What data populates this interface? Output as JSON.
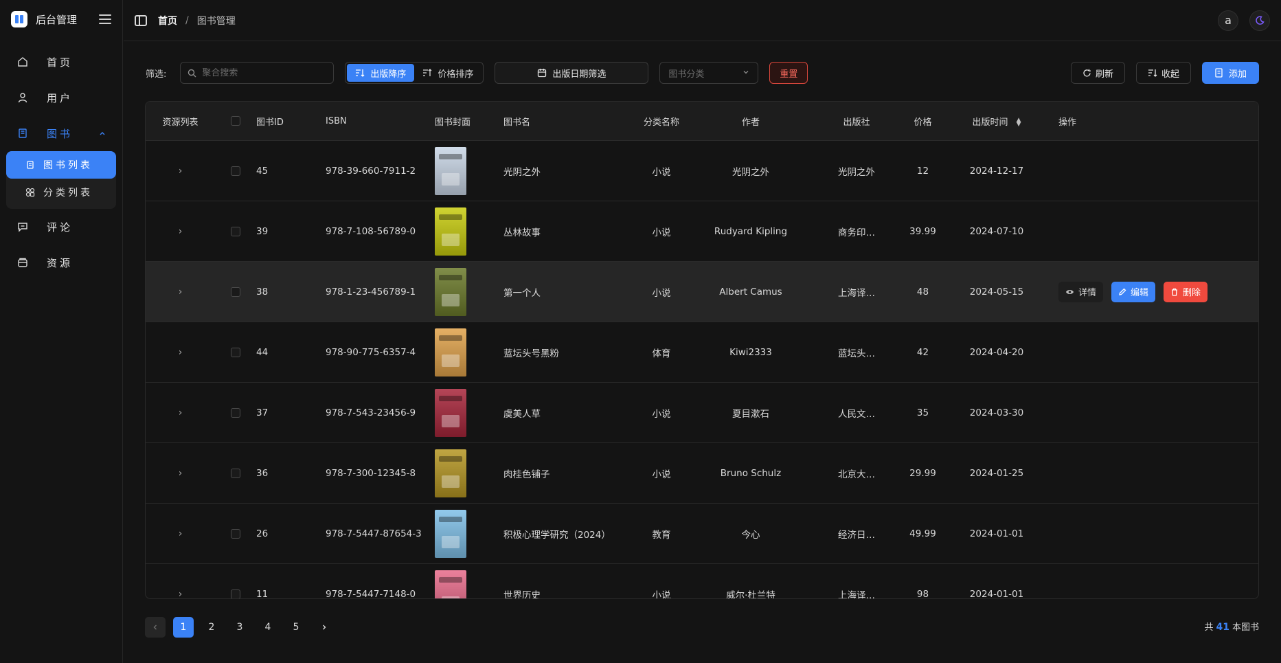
{
  "app": {
    "title": "后台管理"
  },
  "sidebar": {
    "items": [
      {
        "label": "首页",
        "icon": "home-icon"
      },
      {
        "label": "用户",
        "icon": "user-icon"
      },
      {
        "label": "图书",
        "icon": "book-icon",
        "expanded": true
      },
      {
        "label": "评论",
        "icon": "comment-icon"
      },
      {
        "label": "资源",
        "icon": "folder-icon"
      }
    ],
    "sub_items": [
      {
        "label": "图书列表",
        "icon": "list-icon",
        "active": true
      },
      {
        "label": "分类列表",
        "icon": "category-icon"
      }
    ]
  },
  "header": {
    "breadcrumb_home": "首页",
    "breadcrumb_sep": "/",
    "breadcrumb_current": "图书管理",
    "avatar_letter": "a"
  },
  "toolbar": {
    "filter_label": "筛选:",
    "search_placeholder": "聚合搜索",
    "sort_pub_label": "出版降序",
    "sort_price_label": "价格排序",
    "date_filter_label": "出版日期筛选",
    "category_placeholder": "图书分类",
    "reset_label": "重置",
    "refresh_label": "刷新",
    "collapse_label": "收起",
    "add_label": "添加"
  },
  "table": {
    "headers": {
      "resource": "资源列表",
      "id": "图书ID",
      "isbn": "ISBN",
      "cover": "图书封面",
      "name": "图书名",
      "category": "分类名称",
      "author": "作者",
      "publisher": "出版社",
      "price": "价格",
      "date": "出版时间",
      "ops": "操作"
    },
    "rows": [
      {
        "id": "45",
        "isbn": "978-39-660-7911-2",
        "name": "光阴之外",
        "category": "小说",
        "author": "光阴之外",
        "publisher": "光阴之外",
        "price": "12",
        "date": "2024-12-17",
        "cover_color": "#c9d6e6"
      },
      {
        "id": "39",
        "isbn": "978-7-108-56789-0",
        "name": "丛林故事",
        "category": "小说",
        "author": "Rudyard Kipling",
        "publisher": "商务印…",
        "price": "39.99",
        "date": "2024-07-10",
        "cover_color": "#c8cc0e"
      },
      {
        "id": "38",
        "isbn": "978-1-23-456789-1",
        "name": "第一个人",
        "category": "小说",
        "author": "Albert Camus",
        "publisher": "上海译…",
        "price": "48",
        "date": "2024-05-15",
        "cover_color": "#6b7a2a"
      },
      {
        "id": "44",
        "isbn": "978-90-775-6357-4",
        "name": "蓝坛头号黑粉",
        "category": "体育",
        "author": "Kiwi2333",
        "publisher": "蓝坛头…",
        "price": "42",
        "date": "2024-04-20",
        "cover_color": "#e0a24a"
      },
      {
        "id": "37",
        "isbn": "978-7-543-23456-9",
        "name": "虞美人草",
        "category": "小说",
        "author": "夏目漱石",
        "publisher": "人民文…",
        "price": "35",
        "date": "2024-03-30",
        "cover_color": "#a8253a"
      },
      {
        "id": "36",
        "isbn": "978-7-300-12345-8",
        "name": "肉桂色铺子",
        "category": "小说",
        "author": "Bruno Schulz",
        "publisher": "北京大…",
        "price": "29.99",
        "date": "2024-01-25",
        "cover_color": "#b59622"
      },
      {
        "id": "26",
        "isbn": "978-7-5447-87654-3",
        "name": "积极心理学研究（2024）",
        "category": "教育",
        "author": "今心",
        "publisher": "经济日…",
        "price": "49.99",
        "date": "2024-01-01",
        "cover_color": "#7fc0e8"
      },
      {
        "id": "11",
        "isbn": "978-7-5447-7148-0",
        "name": "世界历史",
        "category": "小说",
        "author": "威尔·杜兰特",
        "publisher": "上海译…",
        "price": "98",
        "date": "2024-01-01",
        "cover_color": "#e86a8a"
      }
    ],
    "row_ops": {
      "detail": "详情",
      "edit": "编辑",
      "delete": "删除"
    }
  },
  "pagination": {
    "pages": [
      "1",
      "2",
      "3",
      "4",
      "5"
    ],
    "current": "1",
    "total_prefix": "共",
    "total_count": "41",
    "total_suffix": "本图书"
  },
  "colors": {
    "accent": "#3b82f6",
    "danger": "#f04a3e"
  }
}
